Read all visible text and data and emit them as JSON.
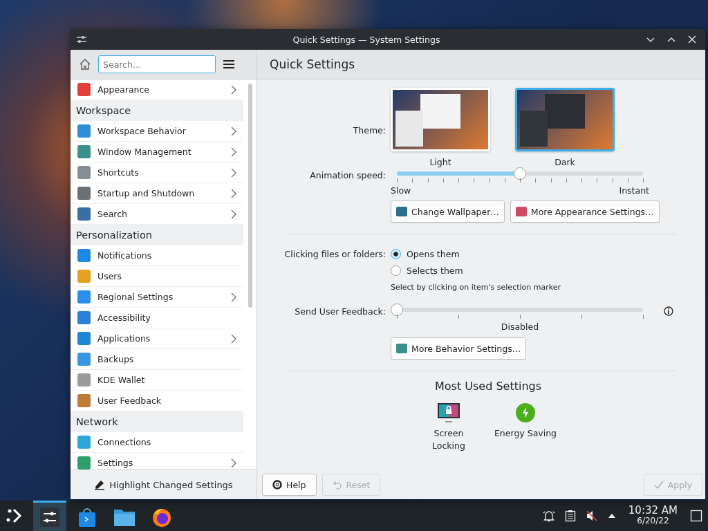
{
  "window": {
    "title": "Quick Settings — System Settings"
  },
  "sidebar": {
    "search": {
      "placeholder": "Search…"
    },
    "items": [
      {
        "kind": "item",
        "label": "Appearance",
        "has_submenu": true
      },
      {
        "kind": "section",
        "label": "Workspace"
      },
      {
        "kind": "item",
        "label": "Workspace Behavior",
        "has_submenu": true
      },
      {
        "kind": "item",
        "label": "Window Management",
        "has_submenu": true
      },
      {
        "kind": "item",
        "label": "Shortcuts",
        "has_submenu": true
      },
      {
        "kind": "item",
        "label": "Startup and Shutdown",
        "has_submenu": true
      },
      {
        "kind": "item",
        "label": "Search",
        "has_submenu": true
      },
      {
        "kind": "section",
        "label": "Personalization"
      },
      {
        "kind": "item",
        "label": "Notifications",
        "has_submenu": false
      },
      {
        "kind": "item",
        "label": "Users",
        "has_submenu": false
      },
      {
        "kind": "item",
        "label": "Regional Settings",
        "has_submenu": true
      },
      {
        "kind": "item",
        "label": "Accessibility",
        "has_submenu": false
      },
      {
        "kind": "item",
        "label": "Applications",
        "has_submenu": true
      },
      {
        "kind": "item",
        "label": "Backups",
        "has_submenu": false
      },
      {
        "kind": "item",
        "label": "KDE Wallet",
        "has_submenu": false
      },
      {
        "kind": "item",
        "label": "User Feedback",
        "has_submenu": false
      },
      {
        "kind": "section",
        "label": "Network"
      },
      {
        "kind": "item",
        "label": "Connections",
        "has_submenu": false
      },
      {
        "kind": "item",
        "label": "Settings",
        "has_submenu": true
      }
    ],
    "footer_button": "Highlight Changed Settings"
  },
  "page": {
    "title": "Quick Settings",
    "theme": {
      "label": "Theme:",
      "options": [
        {
          "label": "Light",
          "selected": false
        },
        {
          "label": "Dark",
          "selected": true
        }
      ]
    },
    "animation": {
      "label": "Animation speed:",
      "level": 0.5,
      "min_label": "Slow",
      "max_label": "Instant"
    },
    "appearance_buttons": [
      "Change Wallpaper…",
      "More Appearance Settings…"
    ],
    "clicking": {
      "label": "Clicking files or folders:",
      "options": [
        {
          "label": "Opens them",
          "selected": true
        },
        {
          "label": "Selects them",
          "selected": false
        }
      ],
      "hint": "Select by clicking on item's selection marker"
    },
    "feedback": {
      "label": "Send User Feedback:",
      "level": 0,
      "value": "Disabled"
    },
    "behavior_button": "More Behavior Settings…",
    "most_used": {
      "title": "Most Used Settings",
      "items": [
        "Screen Locking",
        "Energy Saving"
      ]
    }
  },
  "footer": {
    "buttons": [
      {
        "label": "Help",
        "disabled": false
      },
      {
        "label": "Reset",
        "disabled": true
      },
      {
        "label": "Apply",
        "disabled": true
      }
    ]
  },
  "taskbar": {
    "tasks": [
      {
        "selected": true
      },
      {
        "selected": false
      },
      {
        "selected": false
      },
      {
        "selected": false
      }
    ],
    "time": "10:32 AM",
    "date": "6/20/22"
  }
}
